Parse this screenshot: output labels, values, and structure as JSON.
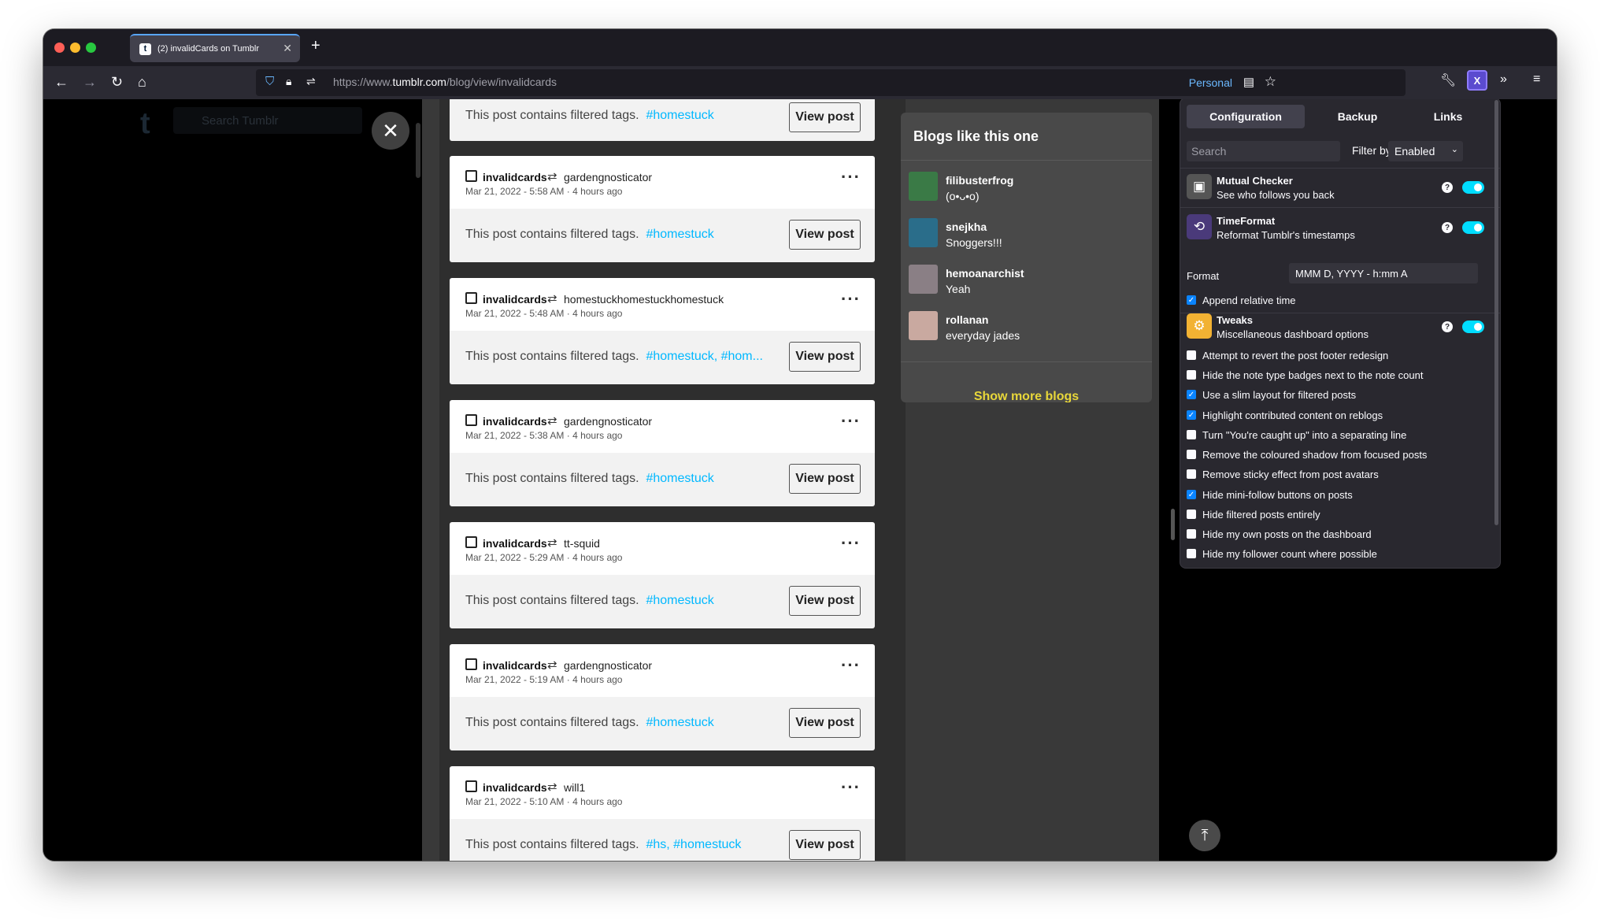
{
  "browser": {
    "tab_title": "(2) invalidCards on Tumblr",
    "tab_favicon": "t",
    "tab_close": "✕",
    "new_tab": "+",
    "url_host": "https://www.",
    "url_domain": "tumblr.com",
    "url_path": "/blog/view/invalidcards",
    "container_label": "Personal"
  },
  "tumblr": {
    "logo": "t",
    "search_placeholder": "Search Tumblr"
  },
  "posts": [
    {
      "author": "",
      "reblogged_from": "",
      "date": "",
      "relative": "",
      "filtered_text": "This post contains filtered tags.",
      "tags": "#homestuck",
      "view_label": "View post"
    },
    {
      "author": "invalidcards",
      "reblogged_from": "gardengnosticator",
      "date": "Mar 21, 2022 - 5:58 AM",
      "relative": "4 hours ago",
      "filtered_text": "This post contains filtered tags.",
      "tags": "#homestuck",
      "view_label": "View post"
    },
    {
      "author": "invalidcards",
      "reblogged_from": "homestuckhomestuckhomestuck",
      "date": "Mar 21, 2022 - 5:48 AM",
      "relative": "4 hours ago",
      "filtered_text": "This post contains filtered tags.",
      "tags": "#homestuck, #hom...",
      "view_label": "View post"
    },
    {
      "author": "invalidcards",
      "reblogged_from": "gardengnosticator",
      "date": "Mar 21, 2022 - 5:38 AM",
      "relative": "4 hours ago",
      "filtered_text": "This post contains filtered tags.",
      "tags": "#homestuck",
      "view_label": "View post"
    },
    {
      "author": "invalidcards",
      "reblogged_from": "tt-squid",
      "date": "Mar 21, 2022 - 5:29 AM",
      "relative": "4 hours ago",
      "filtered_text": "This post contains filtered tags.",
      "tags": "#homestuck",
      "view_label": "View post"
    },
    {
      "author": "invalidcards",
      "reblogged_from": "gardengnosticator",
      "date": "Mar 21, 2022 - 5:19 AM",
      "relative": "4 hours ago",
      "filtered_text": "This post contains filtered tags.",
      "tags": "#homestuck",
      "view_label": "View post"
    },
    {
      "author": "invalidcards",
      "reblogged_from": "will1",
      "date": "Mar 21, 2022 - 5:10 AM",
      "relative": "4 hours ago",
      "filtered_text": "This post contains filtered tags.",
      "tags": "#hs, #homestuck",
      "view_label": "View post"
    }
  ],
  "blogs_widget": {
    "title": "Blogs like this one",
    "items": [
      {
        "name": "filibusterfrog",
        "desc": "(o•ᴗ•o)",
        "avatar_color": "#3a7a46"
      },
      {
        "name": "snejkha",
        "desc": "Snoggers!!!",
        "avatar_color": "#2a6d8a"
      },
      {
        "name": "hemoanarchist",
        "desc": "Yeah",
        "avatar_color": "#8a7f85"
      },
      {
        "name": "rollanan",
        "desc": "everyday jades",
        "avatar_color": "#c9a9a0"
      }
    ],
    "show_more": "Show more blogs"
  },
  "extension": {
    "tabs": [
      "Configuration",
      "Backup",
      "Links"
    ],
    "search_placeholder": "Search",
    "filter_label": "Filter by",
    "filter_value": "Enabled",
    "features": [
      {
        "title": "Mutual Checker",
        "desc": "See who follows you back",
        "icon_color": "#555",
        "enabled": true
      },
      {
        "title": "TimeFormat",
        "desc": "Reformat Tumblr's timestamps",
        "icon_color": "#4a3a7a",
        "enabled": true
      },
      {
        "title": "Tweaks",
        "desc": "Miscellaneous dashboard options",
        "icon_color": "#f2b233",
        "enabled": true
      }
    ],
    "help": "?",
    "format_label": "Format",
    "format_value": "MMM D, YYYY - h:mm A",
    "append_relative": "Append relative time",
    "tweaks": [
      {
        "label": "Attempt to revert the post footer redesign",
        "checked": false
      },
      {
        "label": "Hide the note type badges next to the note count",
        "checked": false
      },
      {
        "label": "Use a slim layout for filtered posts",
        "checked": true
      },
      {
        "label": "Highlight contributed content on reblogs",
        "checked": true
      },
      {
        "label": "Turn \"You're caught up\" into a separating line",
        "checked": false
      },
      {
        "label": "Remove the coloured shadow from focused posts",
        "checked": false
      },
      {
        "label": "Remove sticky effect from post avatars",
        "checked": false
      },
      {
        "label": "Hide mini-follow buttons on posts",
        "checked": true
      },
      {
        "label": "Hide filtered posts entirely",
        "checked": false
      },
      {
        "label": "Hide my own posts on the dashboard",
        "checked": false
      },
      {
        "label": "Hide my follower count where possible",
        "checked": false
      }
    ]
  },
  "colors": {
    "tag": "#00b8ff",
    "accent": "#00ddff",
    "show_more": "#e8d73a"
  }
}
